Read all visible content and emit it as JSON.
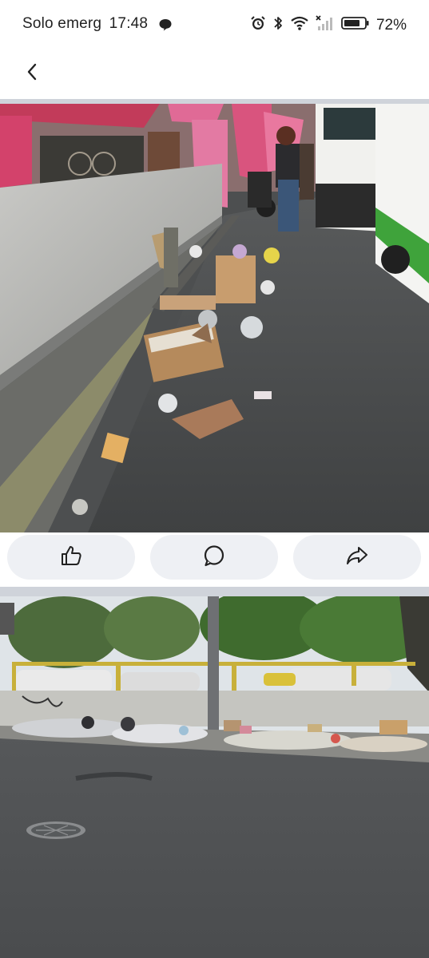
{
  "status_bar": {
    "carrier": "Solo emerg",
    "time": "17:48",
    "battery": "72%",
    "icons": [
      "chat-bubble-icon",
      "alarm-icon",
      "bluetooth-icon",
      "wifi-icon",
      "no-signal-icon",
      "battery-icon"
    ]
  },
  "header": {
    "back_icon": "chevron-left-icon"
  },
  "photos": [
    {
      "subject": "trash-along-market-sidewalk-photo"
    },
    {
      "subject": "trash-along-roadside-wall-photo"
    }
  ],
  "actions": [
    {
      "icon": "thumbs-up-icon"
    },
    {
      "icon": "comment-icon"
    },
    {
      "icon": "share-icon"
    }
  ],
  "colors": {
    "background": "#ffffff",
    "separator": "#cfd3da",
    "button_bg": "#eef0f4",
    "icon": "#222222"
  }
}
